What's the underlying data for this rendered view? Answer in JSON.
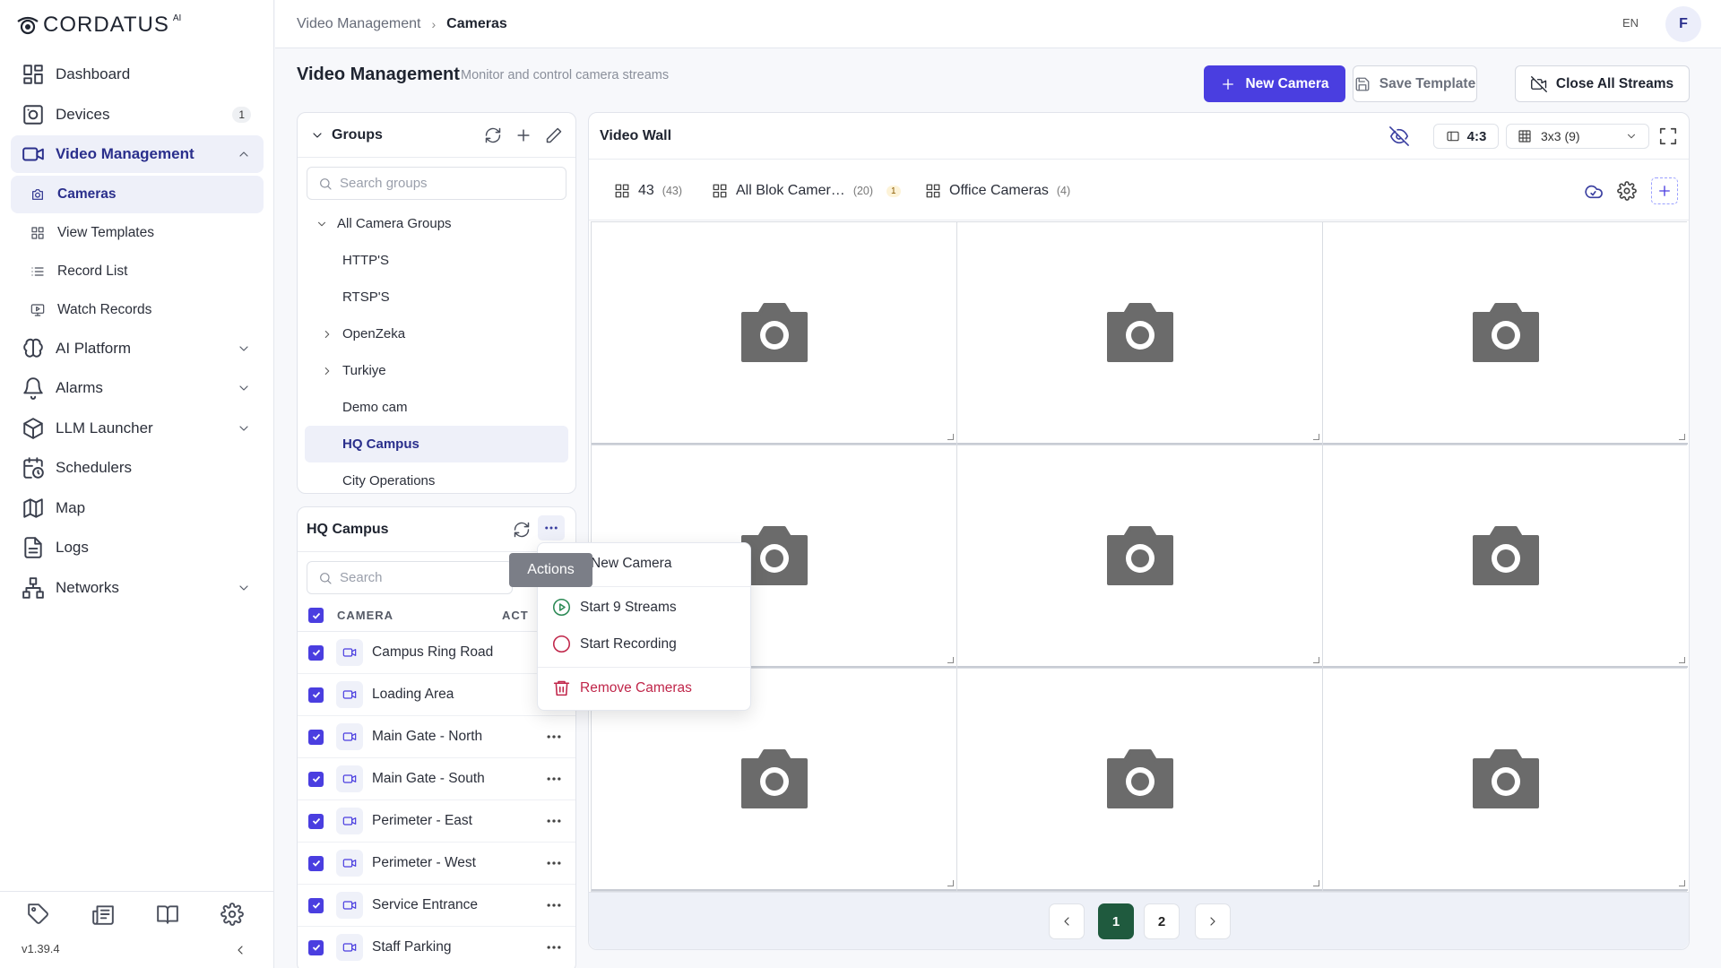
{
  "app": {
    "logo": "CORDATUS",
    "logo_sup": "AI",
    "version": "v1.39.4"
  },
  "sidebar": {
    "items": [
      {
        "label": "Dashboard",
        "icon": "dashboard-icon"
      },
      {
        "label": "Devices",
        "icon": "devices-icon",
        "badge": "1"
      },
      {
        "label": "Video Management",
        "icon": "video-icon"
      },
      {
        "label": "AI Platform",
        "icon": "brain-icon"
      },
      {
        "label": "Alarms",
        "icon": "bell-icon"
      },
      {
        "label": "LLM Launcher",
        "icon": "cube-icon"
      },
      {
        "label": "Schedulers",
        "icon": "calendar-clock-icon"
      },
      {
        "label": "Map",
        "icon": "map-icon"
      },
      {
        "label": "Logs",
        "icon": "logs-icon"
      },
      {
        "label": "Networks",
        "icon": "network-icon"
      }
    ],
    "video_sub": [
      {
        "label": "Cameras"
      },
      {
        "label": "View Templates"
      },
      {
        "label": "Record List"
      },
      {
        "label": "Watch Records"
      }
    ]
  },
  "topbar": {
    "crumb_parent": "Video Management",
    "crumb_current": "Cameras",
    "lang": "EN",
    "avatar": "F"
  },
  "header": {
    "title": "Video Management",
    "subtitle": "Monitor and control camera streams",
    "new_camera": "New Camera",
    "save_template": "Save Template",
    "close_streams": "Close All Streams"
  },
  "groups": {
    "title": "Groups",
    "search_placeholder": "Search groups",
    "root": "All Camera Groups",
    "items": [
      "HTTP'S",
      "RTSP'S",
      "OpenZeka",
      "Turkiye",
      "Demo cam",
      "HQ Campus",
      "City Operations"
    ],
    "selected": "HQ Campus"
  },
  "cameras": {
    "title": "HQ Campus",
    "search_placeholder": "Search",
    "col_camera": "CAMERA",
    "col_actions": "ACT",
    "rows": [
      "Campus Ring Road",
      "Loading Area",
      "Main Gate - North",
      "Main Gate - South",
      "Perimeter - East",
      "Perimeter - West",
      "Service Entrance",
      "Staff Parking"
    ]
  },
  "menu": {
    "tooltip": "Actions",
    "new_camera": "New Camera",
    "start_streams": "Start 9 Streams",
    "start_recording": "Start Recording",
    "remove": "Remove Cameras"
  },
  "wall": {
    "title": "Video Wall",
    "ratio": "4:3",
    "grid": "3x3 (9)",
    "tabs": [
      {
        "label": "43",
        "count": "(43)"
      },
      {
        "label": "All Blok Camer…",
        "count": "(20)",
        "badge": "1"
      },
      {
        "label": "Office Cameras",
        "count": "(4)"
      }
    ],
    "pages": [
      "1",
      "2"
    ],
    "current_page": "1"
  },
  "colors": {
    "accent": "#4a3ee0",
    "active_page": "#1f5a3e",
    "danger": "#c0264a",
    "success": "#2c8a55"
  }
}
